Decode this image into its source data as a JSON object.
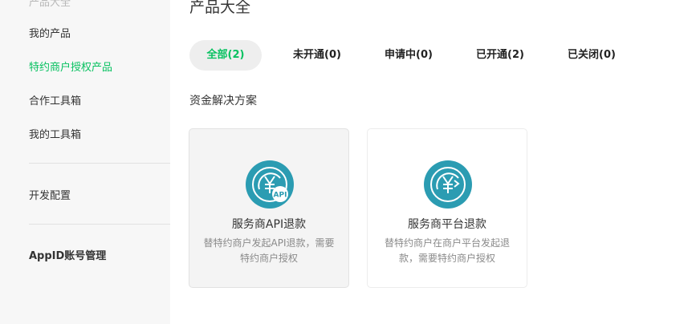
{
  "sidebar": {
    "cut_label": "产品大全",
    "items": [
      {
        "label": "我的产品"
      },
      {
        "label": "特约商户授权产品"
      },
      {
        "label": "合作工具箱"
      },
      {
        "label": "我的工具箱"
      },
      {
        "label": "开发配置"
      },
      {
        "label": "AppID账号管理"
      }
    ],
    "active_color": "#07c160"
  },
  "main": {
    "title": "产品大全",
    "tabs": [
      {
        "label": "全部(2)"
      },
      {
        "label": "未开通(0)"
      },
      {
        "label": "申请中(0)"
      },
      {
        "label": "已开通(2)"
      },
      {
        "label": "已关闭(0)"
      }
    ],
    "section_title": "资金解决方案",
    "cards": [
      {
        "title": "服务商API退款",
        "desc": "替特约商户发起API退款，需要特约商户授权",
        "icon": "api-refund-icon"
      },
      {
        "title": "服务商平台退款",
        "desc": "替特约商户在商户平台发起退款，需要特约商户授权",
        "icon": "platform-refund-icon"
      }
    ],
    "icon_color": "#2b9cb2"
  }
}
